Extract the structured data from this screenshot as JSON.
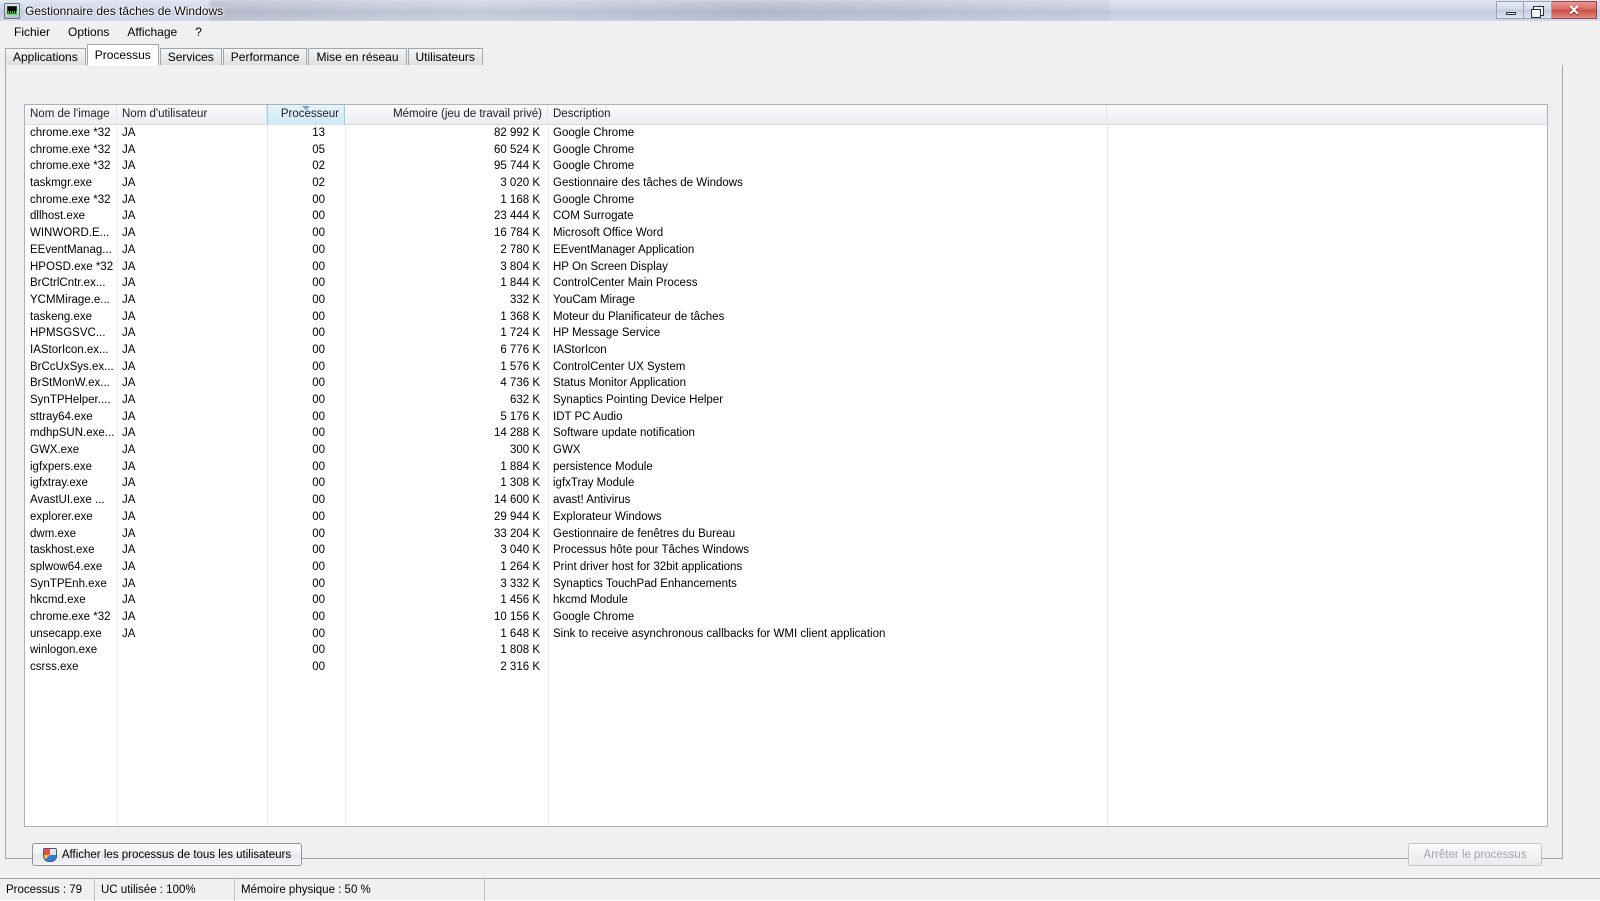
{
  "window": {
    "title": "Gestionnaire des tâches de Windows",
    "app_icon": "task-manager-icon",
    "minimize_label": "",
    "maximize_label": "",
    "close_label": "✕"
  },
  "menu": {
    "items": [
      {
        "label": "Fichier"
      },
      {
        "label": "Options"
      },
      {
        "label": "Affichage"
      },
      {
        "label": "?"
      }
    ]
  },
  "tabs": [
    {
      "label": "Applications",
      "active": false
    },
    {
      "label": "Processus",
      "active": true
    },
    {
      "label": "Services",
      "active": false
    },
    {
      "label": "Performance",
      "active": false
    },
    {
      "label": "Mise en réseau",
      "active": false
    },
    {
      "label": "Utilisateurs",
      "active": false
    }
  ],
  "table": {
    "sort_column": "Processeur",
    "sort_direction": "descending",
    "columns": [
      {
        "key": "name",
        "label": "Nom de l'image"
      },
      {
        "key": "user",
        "label": "Nom d'utilisateur"
      },
      {
        "key": "cpu",
        "label": "Processeur"
      },
      {
        "key": "mem",
        "label": "Mémoire (jeu de travail privé)"
      },
      {
        "key": "desc",
        "label": "Description"
      }
    ],
    "rows": [
      {
        "name": "chrome.exe *32",
        "user": "JA",
        "cpu": "13",
        "mem": "82 992 K",
        "desc": "Google Chrome"
      },
      {
        "name": "chrome.exe *32",
        "user": "JA",
        "cpu": "05",
        "mem": "60 524 K",
        "desc": "Google Chrome"
      },
      {
        "name": "chrome.exe *32",
        "user": "JA",
        "cpu": "02",
        "mem": "95 744 K",
        "desc": "Google Chrome"
      },
      {
        "name": "taskmgr.exe",
        "user": "JA",
        "cpu": "02",
        "mem": "3 020 K",
        "desc": "Gestionnaire des tâches de Windows"
      },
      {
        "name": "chrome.exe *32",
        "user": "JA",
        "cpu": "00",
        "mem": "1 168 K",
        "desc": "Google Chrome"
      },
      {
        "name": "dllhost.exe",
        "user": "JA",
        "cpu": "00",
        "mem": "23 444 K",
        "desc": "COM Surrogate"
      },
      {
        "name": "WINWORD.E...",
        "user": "JA",
        "cpu": "00",
        "mem": "16 784 K",
        "desc": "Microsoft Office Word"
      },
      {
        "name": "EEventManag...",
        "user": "JA",
        "cpu": "00",
        "mem": "2 780 K",
        "desc": "EEventManager Application"
      },
      {
        "name": "HPOSD.exe *32",
        "user": "JA",
        "cpu": "00",
        "mem": "3 804 K",
        "desc": "HP On Screen Display"
      },
      {
        "name": "BrCtrlCntr.ex...",
        "user": "JA",
        "cpu": "00",
        "mem": "1 844 K",
        "desc": "ControlCenter Main Process"
      },
      {
        "name": "YCMMirage.e...",
        "user": "JA",
        "cpu": "00",
        "mem": "332 K",
        "desc": "YouCam Mirage"
      },
      {
        "name": "taskeng.exe",
        "user": "JA",
        "cpu": "00",
        "mem": "1 368 K",
        "desc": "Moteur du Planificateur de tâches"
      },
      {
        "name": "HPMSGSVC...",
        "user": "JA",
        "cpu": "00",
        "mem": "1 724 K",
        "desc": "HP Message Service"
      },
      {
        "name": "IAStorIcon.ex...",
        "user": "JA",
        "cpu": "00",
        "mem": "6 776 K",
        "desc": "IAStorIcon"
      },
      {
        "name": "BrCcUxSys.ex...",
        "user": "JA",
        "cpu": "00",
        "mem": "1 576 K",
        "desc": "ControlCenter UX System"
      },
      {
        "name": "BrStMonW.ex...",
        "user": "JA",
        "cpu": "00",
        "mem": "4 736 K",
        "desc": "Status Monitor Application"
      },
      {
        "name": "SynTPHelper....",
        "user": "JA",
        "cpu": "00",
        "mem": "632 K",
        "desc": "Synaptics Pointing Device Helper"
      },
      {
        "name": "sttray64.exe",
        "user": "JA",
        "cpu": "00",
        "mem": "5 176 K",
        "desc": "IDT PC Audio"
      },
      {
        "name": "mdhpSUN.exe...",
        "user": "JA",
        "cpu": "00",
        "mem": "14 288 K",
        "desc": "Software update notification"
      },
      {
        "name": "GWX.exe",
        "user": "JA",
        "cpu": "00",
        "mem": "300 K",
        "desc": "GWX"
      },
      {
        "name": "igfxpers.exe",
        "user": "JA",
        "cpu": "00",
        "mem": "1 884 K",
        "desc": "persistence Module"
      },
      {
        "name": "igfxtray.exe",
        "user": "JA",
        "cpu": "00",
        "mem": "1 308 K",
        "desc": "igfxTray Module"
      },
      {
        "name": "AvastUI.exe ...",
        "user": "JA",
        "cpu": "00",
        "mem": "14 600 K",
        "desc": "avast! Antivirus"
      },
      {
        "name": "explorer.exe",
        "user": "JA",
        "cpu": "00",
        "mem": "29 944 K",
        "desc": "Explorateur Windows"
      },
      {
        "name": "dwm.exe",
        "user": "JA",
        "cpu": "00",
        "mem": "33 204 K",
        "desc": "Gestionnaire de fenêtres du Bureau"
      },
      {
        "name": "taskhost.exe",
        "user": "JA",
        "cpu": "00",
        "mem": "3 040 K",
        "desc": "Processus hôte pour Tâches Windows"
      },
      {
        "name": "splwow64.exe",
        "user": "JA",
        "cpu": "00",
        "mem": "1 264 K",
        "desc": "Print driver host for 32bit applications"
      },
      {
        "name": "SynTPEnh.exe",
        "user": "JA",
        "cpu": "00",
        "mem": "3 332 K",
        "desc": "Synaptics TouchPad Enhancements"
      },
      {
        "name": "hkcmd.exe",
        "user": "JA",
        "cpu": "00",
        "mem": "1 456 K",
        "desc": "hkcmd Module"
      },
      {
        "name": "chrome.exe *32",
        "user": "JA",
        "cpu": "00",
        "mem": "10 156 K",
        "desc": "Google Chrome"
      },
      {
        "name": "unsecapp.exe",
        "user": "JA",
        "cpu": "00",
        "mem": "1 648 K",
        "desc": "Sink to receive asynchronous callbacks for WMI client application"
      },
      {
        "name": "winlogon.exe",
        "user": "",
        "cpu": "00",
        "mem": "1 808 K",
        "desc": ""
      },
      {
        "name": "csrss.exe",
        "user": "",
        "cpu": "00",
        "mem": "2 316 K",
        "desc": ""
      }
    ]
  },
  "buttons": {
    "show_all_users": "Afficher les processus de tous les utilisateurs",
    "end_process": "Arrêter le processus"
  },
  "statusbar": {
    "processes": "Processus : 79",
    "cpu_usage": "UC utilisée : 100%",
    "physical_memory": "Mémoire physique : 50 %"
  }
}
